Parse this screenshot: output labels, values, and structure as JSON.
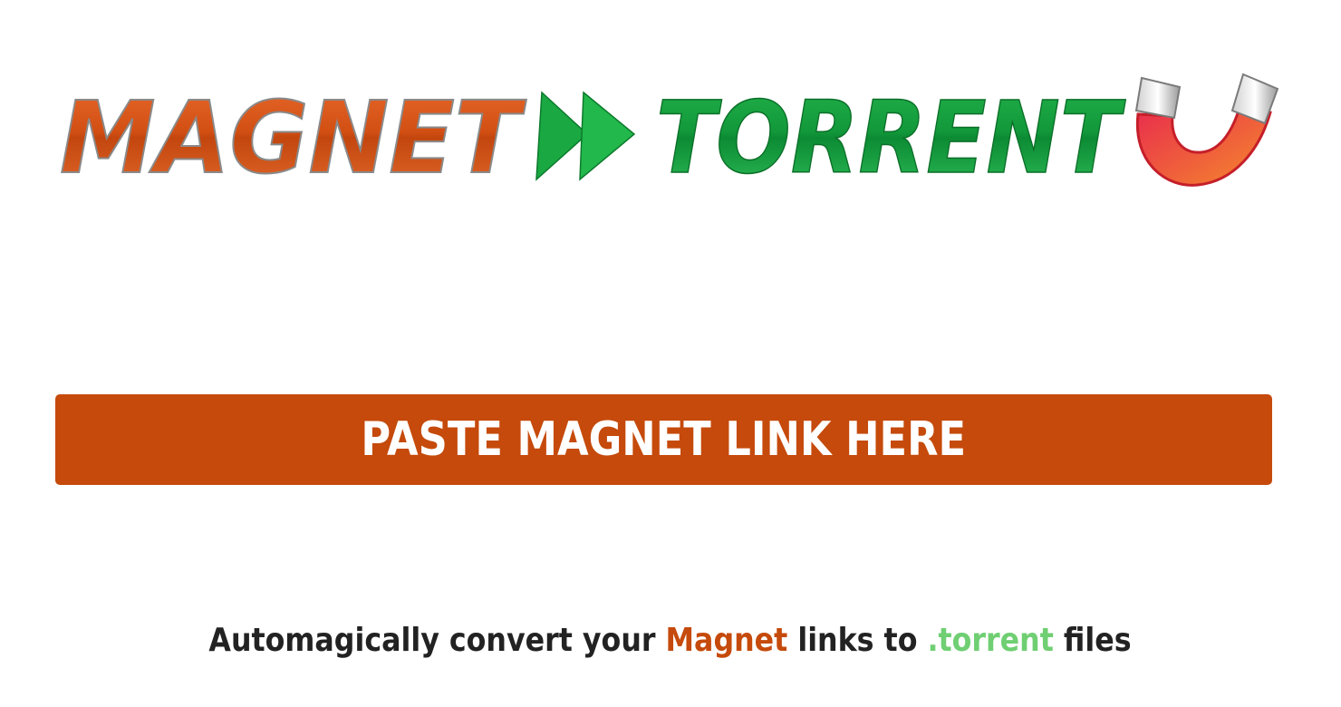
{
  "logo": {
    "word_magnet": "MAGNET",
    "word_torrent": "TORRENT",
    "magnet_color": "#d9531a",
    "torrent_color": "#17a640",
    "arrow_icon": "fast-forward-icon",
    "magnet_icon": "horseshoe-magnet-icon"
  },
  "paste_button": {
    "label": "PASTE MAGNET LINK HERE",
    "color": "#c54a0b"
  },
  "tagline": {
    "part1": "Automagically convert your ",
    "magnet": "Magnet",
    "part2": " links to ",
    "torrent": ".torrent",
    "part3": " files",
    "magnet_color": "#c54a0b",
    "torrent_color": "#6fcf72"
  }
}
